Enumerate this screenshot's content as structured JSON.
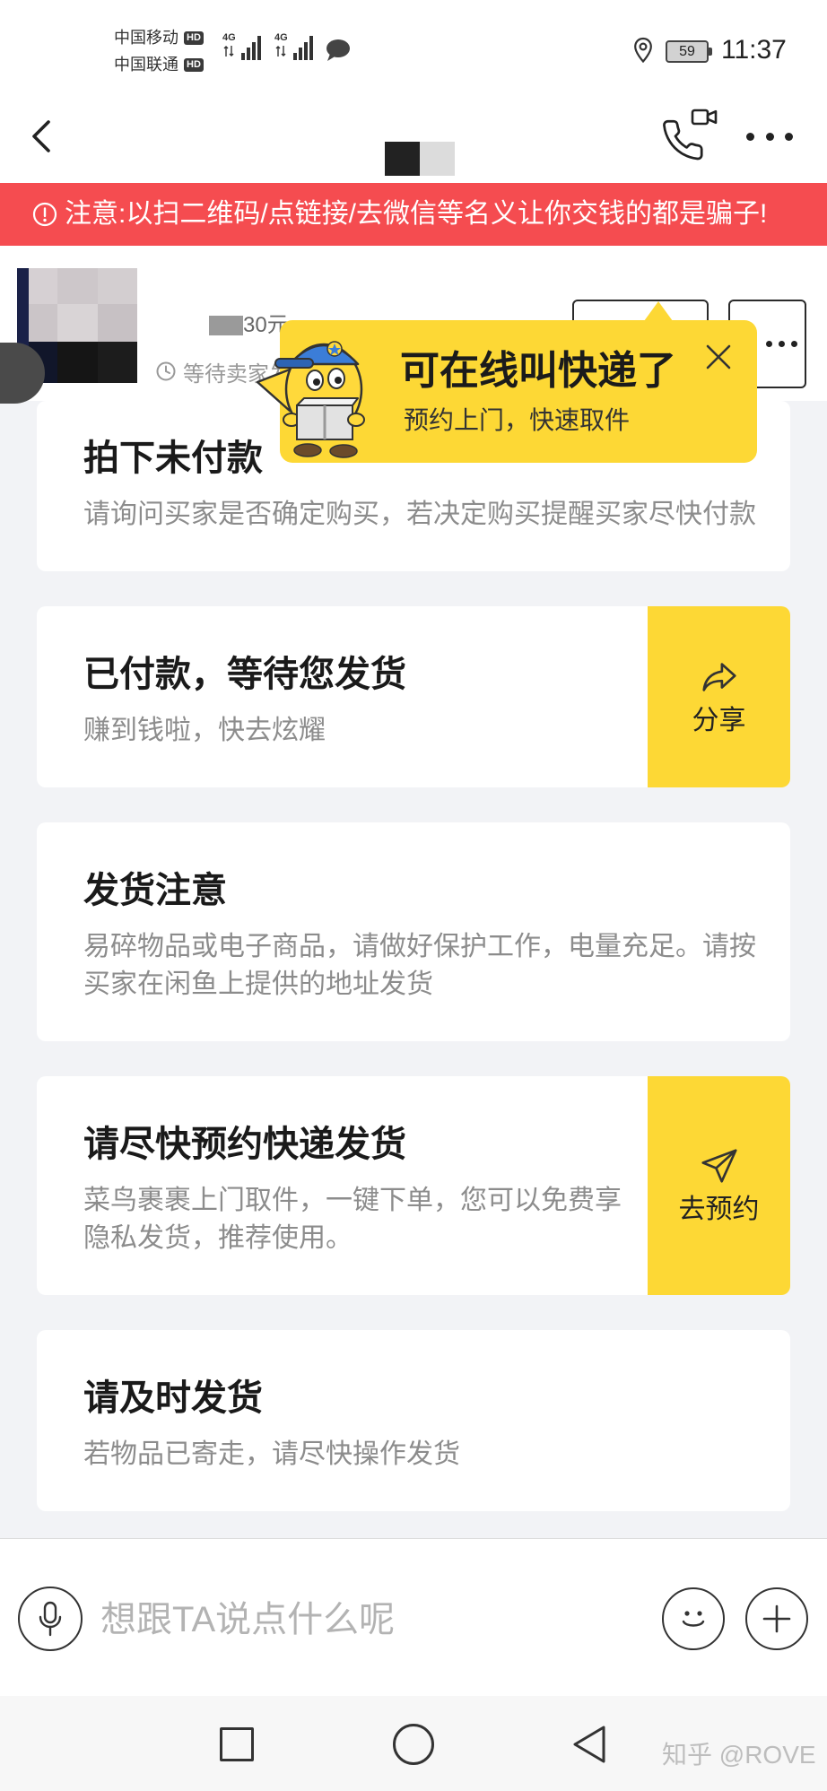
{
  "status_bar": {
    "carriers": [
      {
        "name": "中国移动",
        "badge": "HD",
        "network": "4G"
      },
      {
        "name": "中国联通",
        "badge": "HD",
        "network": "4G"
      }
    ],
    "battery": "59",
    "time": "11:37",
    "icons": [
      "signal-icon",
      "message-icon",
      "location-icon",
      "battery-icon"
    ]
  },
  "header": {
    "icons": {
      "back": "chevron-left-icon",
      "call": "phone-video-icon",
      "more": "more-icon"
    }
  },
  "banner": {
    "icon": "alert-circle-icon",
    "text": "注意:以扫二维码/点链接/去微信等名义让你交钱的都是骗子!"
  },
  "product": {
    "price": "30元",
    "status": "等待卖家发",
    "status_icon": "clock-icon"
  },
  "popup": {
    "title": "可在线叫快递了",
    "subtitle": "预约上门，快速取件",
    "close_icon": "close-icon"
  },
  "cards": [
    {
      "title": "拍下未付款",
      "desc_lines": [
        "请询问买家是否确定购买，若决定购买提醒买家尽快付款"
      ]
    },
    {
      "title": "已付款，等待您发货",
      "desc_lines": [
        "赚到钱啦，快去炫耀"
      ],
      "action": {
        "label": "分享",
        "icon": "share-icon"
      }
    },
    {
      "title": "发货注意",
      "desc_lines": [
        "易碎物品或电子商品，请做好保护工作，电量充足。请按",
        "买家在闲鱼上提供的地址发货"
      ]
    },
    {
      "title": "请尽快预约快递发货",
      "desc_lines": [
        "菜鸟裹裹上门取件，一键下单，您可以免费享",
        "隐私发货，推荐使用。"
      ],
      "action": {
        "label": "去预约",
        "icon": "paper-plane-icon"
      }
    },
    {
      "title": "请及时发货",
      "desc_lines": [
        "若物品已寄走，请尽快操作发货"
      ]
    }
  ],
  "input": {
    "placeholder": "想跟TA说点什么呢",
    "icons": {
      "voice": "microphone-icon",
      "emoji": "emoji-icon",
      "more": "plus-icon"
    }
  },
  "nav": {
    "icons": [
      "recent-apps-icon",
      "home-icon",
      "back-icon"
    ]
  },
  "watermark": "知乎 @ROVE",
  "colors": {
    "accent_yellow": "#fdd835",
    "banner_red": "#f54c50",
    "page_background": "#f2f3f6"
  }
}
